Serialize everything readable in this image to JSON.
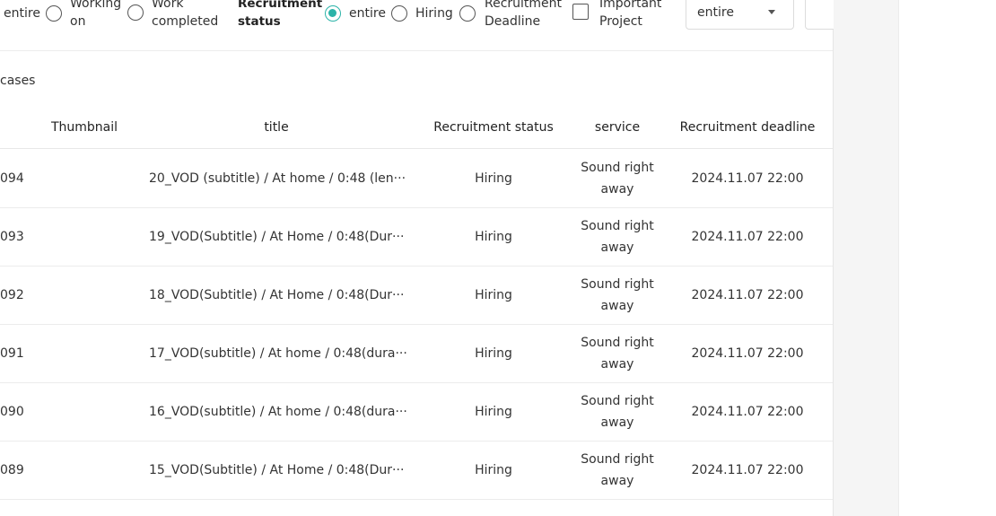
{
  "filters": {
    "status_opts": [
      {
        "label": "entire",
        "checked": false
      },
      {
        "label": "Working on",
        "checked": false
      },
      {
        "label": "Work completed",
        "checked": false
      }
    ],
    "recruit_title": "Recruitment status",
    "recruit_opts": [
      {
        "label": "entire",
        "checked": true
      },
      {
        "label": "Hiring",
        "checked": false
      },
      {
        "label": "Recruitment Deadline",
        "checked": false
      }
    ],
    "important_label": "Important Project",
    "select_value": "entire"
  },
  "count_text": "cases",
  "table": {
    "headers": [
      "Thumbnail",
      "title",
      "Recruitment status",
      "service",
      "Recruitment deadline"
    ],
    "rows": [
      {
        "id": "094",
        "title": "20_VOD (subtitle) / At home / 0:48 (len···",
        "status": "Hiring",
        "service": "Sound right away",
        "deadline": "2024.11.07 22:00"
      },
      {
        "id": "093",
        "title": "19_VOD(Subtitle) / At Home / 0:48(Dur···",
        "status": "Hiring",
        "service": "Sound right away",
        "deadline": "2024.11.07 22:00"
      },
      {
        "id": "092",
        "title": "18_VOD(Subtitle) / At Home / 0:48(Dur···",
        "status": "Hiring",
        "service": "Sound right away",
        "deadline": "2024.11.07 22:00"
      },
      {
        "id": "091",
        "title": "17_VOD(subtitle) / At home / 0:48(dura···",
        "status": "Hiring",
        "service": "Sound right away",
        "deadline": "2024.11.07 22:00"
      },
      {
        "id": "090",
        "title": "16_VOD(subtitle) / At home / 0:48(dura···",
        "status": "Hiring",
        "service": "Sound right away",
        "deadline": "2024.11.07 22:00"
      },
      {
        "id": "089",
        "title": "15_VOD(Subtitle) / At Home / 0:48(Dur···",
        "status": "Hiring",
        "service": "Sound right away",
        "deadline": "2024.11.07 22:00"
      }
    ]
  },
  "colors": {
    "accent": "#2bb3a8",
    "border": "#ececec"
  }
}
